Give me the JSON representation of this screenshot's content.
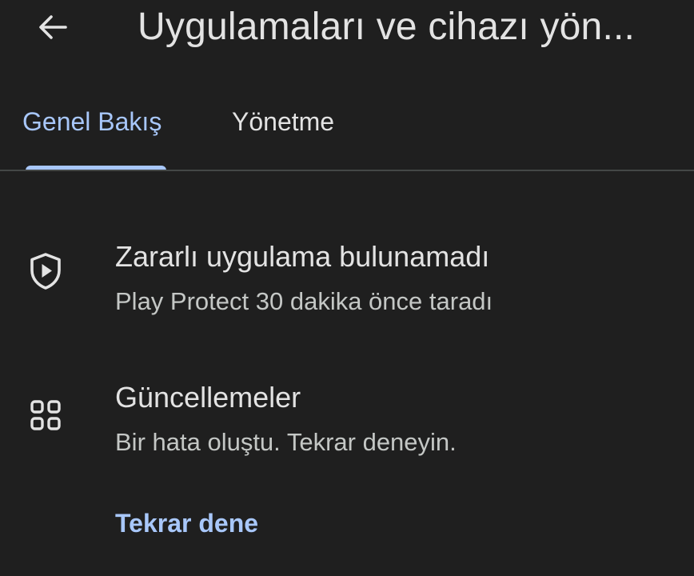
{
  "header": {
    "title": "Uygulamaları ve cihazı yön...",
    "back_icon": "arrow-left-icon"
  },
  "tabs": [
    {
      "label": "Genel Bakış",
      "active": true
    },
    {
      "label": "Yönetme",
      "active": false
    }
  ],
  "overview": {
    "protect": {
      "icon": "shield-play-icon",
      "title": "Zararlı uygulama bulunamadı",
      "subtitle": "Play Protect 30 dakika önce taradı"
    },
    "updates": {
      "icon": "apps-grid-icon",
      "title": "Güncellemeler",
      "subtitle": "Bir hata oluştu. Tekrar deneyin.",
      "retry_label": "Tekrar dene"
    }
  },
  "colors": {
    "background": "#1f1f1f",
    "accent": "#a8c7fa",
    "text_primary": "#e3e3e3",
    "text_secondary": "#c4c7c5",
    "divider": "#444746"
  }
}
